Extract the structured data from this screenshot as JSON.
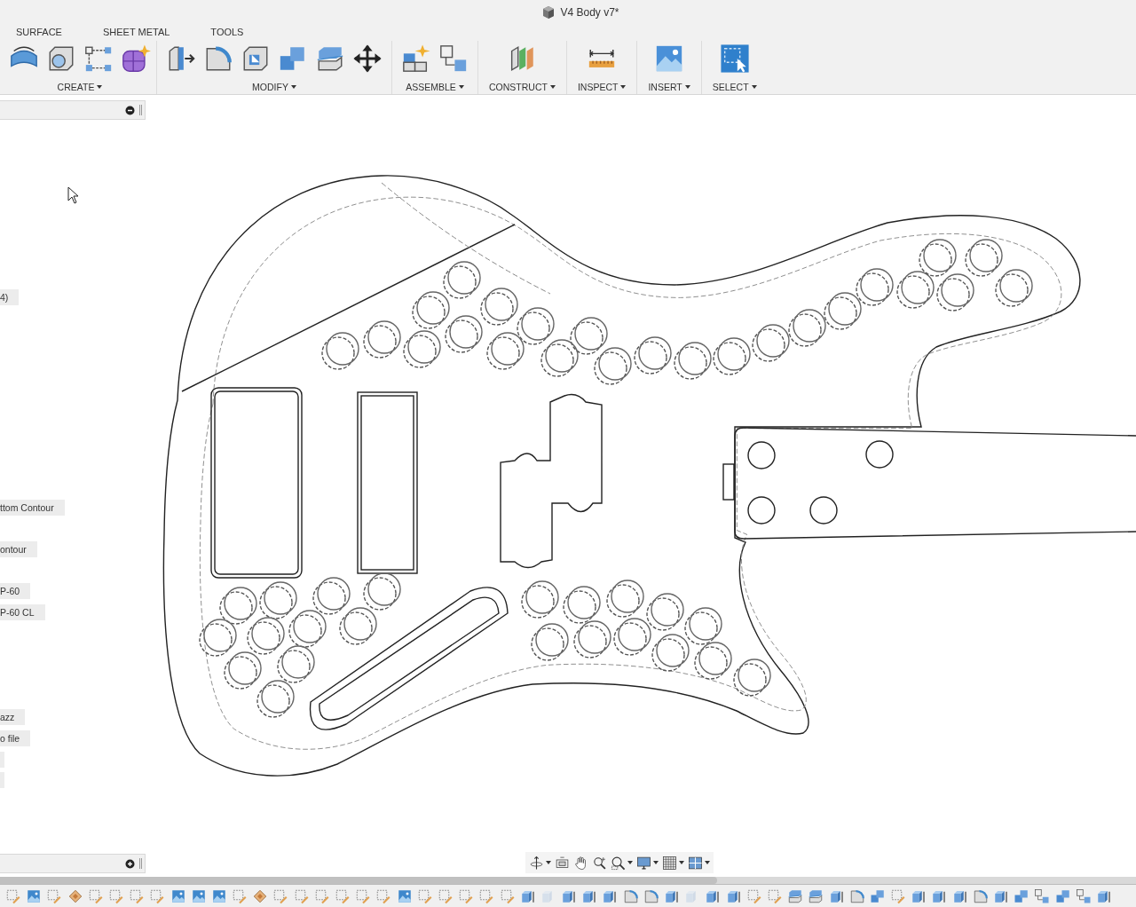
{
  "window": {
    "title": "V4 Body v7*"
  },
  "tabs": [
    {
      "label": "SURFACE",
      "selected": false
    },
    {
      "label": "SHEET METAL",
      "selected": false
    },
    {
      "label": "TOOLS",
      "selected": false
    }
  ],
  "ribbon_groups": [
    {
      "label": "CREATE",
      "tools": [
        {
          "kind": "arc-surface"
        },
        {
          "kind": "cube-hole"
        },
        {
          "kind": "sketch-nodes"
        },
        {
          "kind": "form"
        }
      ]
    },
    {
      "label": "MODIFY",
      "tools": [
        {
          "kind": "press-pull"
        },
        {
          "kind": "fillet"
        },
        {
          "kind": "shell"
        },
        {
          "kind": "combine"
        },
        {
          "kind": "split"
        },
        {
          "kind": "move"
        }
      ]
    },
    {
      "label": "ASSEMBLE",
      "tools": [
        {
          "kind": "new-component"
        },
        {
          "kind": "joint"
        }
      ]
    },
    {
      "label": "CONSTRUCT",
      "tools": [
        {
          "kind": "planes"
        }
      ]
    },
    {
      "label": "INSPECT",
      "tools": [
        {
          "kind": "measure"
        }
      ]
    },
    {
      "label": "INSERT",
      "tools": [
        {
          "kind": "image"
        }
      ]
    },
    {
      "label": "SELECT",
      "tools": [
        {
          "kind": "select"
        }
      ]
    }
  ],
  "browser": {
    "rows": [
      {
        "kind": "blank"
      },
      {
        "kind": "blank"
      },
      {
        "kind": "blank"
      },
      {
        "kind": "blank"
      },
      {
        "kind": "blank"
      },
      {
        "kind": "blank"
      },
      {
        "kind": "blank"
      },
      {
        "kind": "label",
        "label": "4)"
      },
      {
        "kind": "blank"
      },
      {
        "kind": "blank"
      },
      {
        "kind": "blank"
      },
      {
        "kind": "blank"
      },
      {
        "kind": "blank"
      },
      {
        "kind": "blank"
      },
      {
        "kind": "blank"
      },
      {
        "kind": "blank"
      },
      {
        "kind": "blank"
      },
      {
        "kind": "label",
        "label": "ttom Contour"
      },
      {
        "kind": "blank"
      },
      {
        "kind": "label",
        "label": "ontour"
      },
      {
        "kind": "blank"
      },
      {
        "kind": "label",
        "label": "P-60"
      },
      {
        "kind": "label",
        "label": "P-60 CL"
      },
      {
        "kind": "blank"
      },
      {
        "kind": "blank"
      },
      {
        "kind": "blank"
      },
      {
        "kind": "blank"
      },
      {
        "kind": "label",
        "label": "azz"
      },
      {
        "kind": "label",
        "label": "o file"
      },
      {
        "kind": "chip"
      },
      {
        "kind": "chip"
      }
    ]
  },
  "nav_bar": [
    {
      "kind": "orbit",
      "has_menu": true
    },
    {
      "kind": "look-at",
      "has_menu": false
    },
    {
      "kind": "pan",
      "has_menu": false
    },
    {
      "kind": "zoom",
      "has_menu": false
    },
    {
      "kind": "fit",
      "has_menu": true
    },
    {
      "kind": "display",
      "has_menu": true
    },
    {
      "kind": "grid",
      "has_menu": true
    },
    {
      "kind": "viewports",
      "has_menu": true
    }
  ],
  "timeline": [
    {
      "kind": "sketch"
    },
    {
      "kind": "canvas"
    },
    {
      "kind": "sketch"
    },
    {
      "kind": "decal"
    },
    {
      "kind": "sketch"
    },
    {
      "kind": "sketch"
    },
    {
      "kind": "sketch"
    },
    {
      "kind": "sketch"
    },
    {
      "kind": "canvas"
    },
    {
      "kind": "canvas"
    },
    {
      "kind": "canvas"
    },
    {
      "kind": "sketch"
    },
    {
      "kind": "decal"
    },
    {
      "kind": "sketch"
    },
    {
      "kind": "sketch"
    },
    {
      "kind": "sketch"
    },
    {
      "kind": "sketch"
    },
    {
      "kind": "sketch"
    },
    {
      "kind": "sketch"
    },
    {
      "kind": "canvas"
    },
    {
      "kind": "sketch"
    },
    {
      "kind": "sketch"
    },
    {
      "kind": "sketch"
    },
    {
      "kind": "sketch"
    },
    {
      "kind": "sketch"
    },
    {
      "kind": "body"
    },
    {
      "kind": "ghost"
    },
    {
      "kind": "body"
    },
    {
      "kind": "body"
    },
    {
      "kind": "body"
    },
    {
      "kind": "fillet"
    },
    {
      "kind": "fillet"
    },
    {
      "kind": "body"
    },
    {
      "kind": "ghost"
    },
    {
      "kind": "body"
    },
    {
      "kind": "body"
    },
    {
      "kind": "sketch"
    },
    {
      "kind": "sketch"
    },
    {
      "kind": "split"
    },
    {
      "kind": "split"
    },
    {
      "kind": "body"
    },
    {
      "kind": "fillet"
    },
    {
      "kind": "combine"
    },
    {
      "kind": "sketch"
    },
    {
      "kind": "body"
    },
    {
      "kind": "body"
    },
    {
      "kind": "body"
    },
    {
      "kind": "fillet"
    },
    {
      "kind": "body"
    },
    {
      "kind": "combine"
    },
    {
      "kind": "joint"
    },
    {
      "kind": "combine"
    },
    {
      "kind": "joint"
    },
    {
      "kind": "body"
    }
  ]
}
